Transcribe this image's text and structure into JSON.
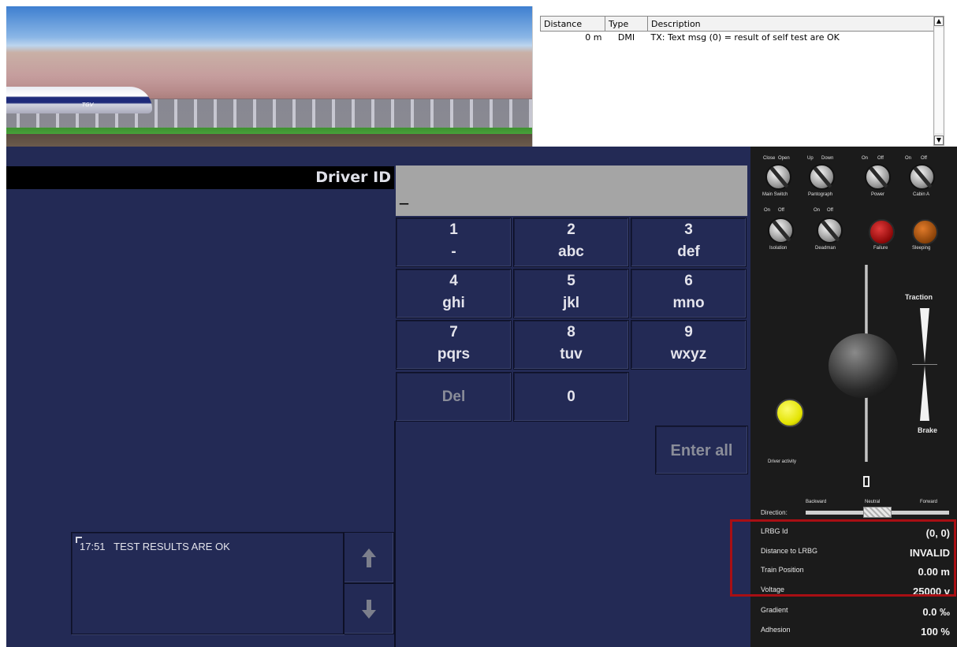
{
  "log": {
    "headers": [
      "Distance",
      "Type",
      "Description"
    ],
    "rows": [
      {
        "distance": "0 m",
        "type": "DMI",
        "description": "TX: Text msg (0) = result of self test are OK"
      }
    ]
  },
  "scene": {
    "train_label": "TGV"
  },
  "dmi": {
    "title": "Driver ID",
    "field_value": "_",
    "keys": [
      {
        "number": "1",
        "letters": "-"
      },
      {
        "number": "2",
        "letters": "abc"
      },
      {
        "number": "3",
        "letters": "def"
      },
      {
        "number": "4",
        "letters": "ghi"
      },
      {
        "number": "5",
        "letters": "jkl"
      },
      {
        "number": "6",
        "letters": "mno"
      },
      {
        "number": "7",
        "letters": "pqrs"
      },
      {
        "number": "8",
        "letters": "tuv"
      },
      {
        "number": "9",
        "letters": "wxyz"
      }
    ],
    "del_label": "Del",
    "zero_label": "0",
    "enter_label": "Enter all",
    "message_time": "17:51",
    "message_text": "TEST RESULTS ARE OK"
  },
  "panel": {
    "switches": [
      {
        "label": "Main Switch",
        "left": "Close",
        "right": "Open"
      },
      {
        "label": "Pantograph",
        "left": "Up",
        "right": "Down"
      },
      {
        "label": "Power",
        "left": "On",
        "right": "Off"
      },
      {
        "label": "Cabin A",
        "left": "On",
        "right": "Off"
      },
      {
        "label": "Isolation",
        "left": "On",
        "right": "Off"
      },
      {
        "label": "Deadman",
        "left": "On",
        "right": "Off"
      }
    ],
    "lamps": {
      "failure": "Failure",
      "sleeping": "Sleeping",
      "driver_activity": "Driver activity"
    },
    "traction_label": "Traction",
    "brake_label": "Brake",
    "direction": {
      "label": "Direction:",
      "backward": "Backward",
      "neutral": "Neutral",
      "forward": "Forward"
    },
    "info": [
      {
        "label": "LRBG Id",
        "value": "(0, 0)"
      },
      {
        "label": "Distance to LRBG",
        "value": "INVALID"
      },
      {
        "label": "Train Position",
        "value": "0.00  m"
      },
      {
        "label": "Voltage",
        "value": "25000 v"
      },
      {
        "label": "Gradient",
        "value": "0.0 ‰"
      },
      {
        "label": "Adhesion",
        "value": "100 %"
      }
    ]
  },
  "colors": {
    "dmi_background": "#232a55",
    "panel_background": "#1b1b1b",
    "highlight_border": "#a80f14"
  }
}
